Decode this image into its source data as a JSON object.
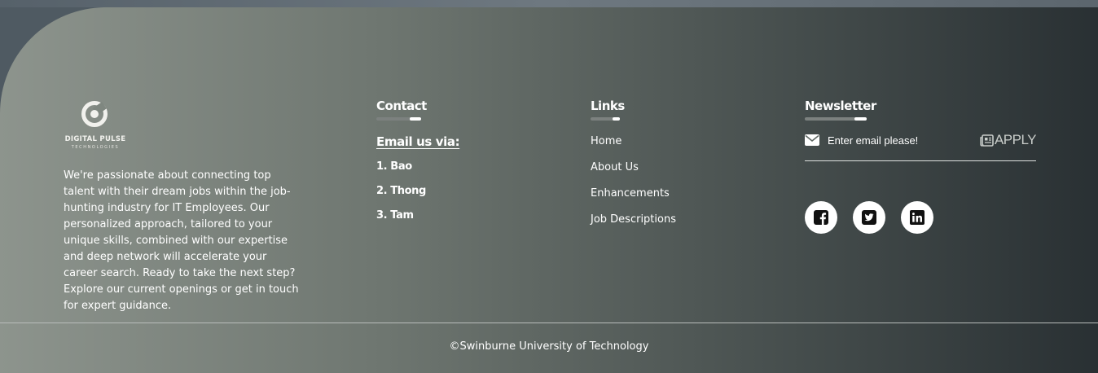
{
  "brand": {
    "name": "DIGITAL PULSE",
    "tagline": "TECHNOLOGIES"
  },
  "about_text": "We're passionate about connecting top talent with their dream jobs within the job-hunting industry for IT Employees. Our personalized approach, tailored to your unique skills, combined with our expertise and deep network will accelerate your career search. Ready to take the next step? Explore our current openings or get in touch for expert guidance.",
  "contact": {
    "title": "Contact",
    "email_label": "Email us via:",
    "people": [
      "1. Bao",
      "2. Thong",
      "3. Tam"
    ]
  },
  "links": {
    "title": "Links",
    "items": [
      "Home",
      "About Us",
      "Enhancements",
      "Job Descriptions"
    ]
  },
  "newsletter": {
    "title": "Newsletter",
    "placeholder": "Enter email please!",
    "button_label": "APPLY",
    "mail_icon": "envelope-icon",
    "button_icon": "newspaper-icon"
  },
  "socials": [
    {
      "name": "facebook",
      "icon": "facebook-icon"
    },
    {
      "name": "twitter",
      "icon": "twitter-icon"
    },
    {
      "name": "linkedin",
      "icon": "linkedin-icon"
    }
  ],
  "copyright": "©Swinburne University of Technology",
  "colors": {
    "footer_gradient_start": "#8d948d",
    "footer_gradient_end": "#293033",
    "text": "#ffffff",
    "accent_underline": "#ffffff",
    "social_bg": "#ffffff",
    "social_icon": "#111111"
  }
}
